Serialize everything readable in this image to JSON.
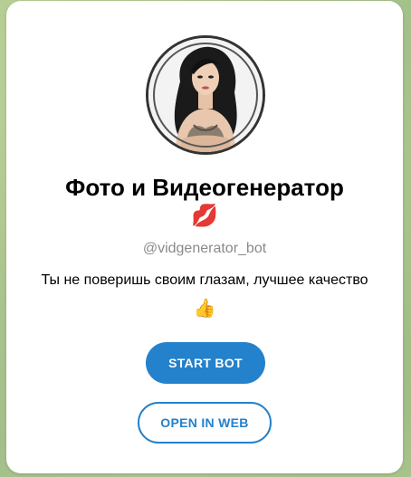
{
  "bot": {
    "title": "Фото и Видеогенератор",
    "title_emoji": "💋",
    "username": "@vidgenerator_bot",
    "description": "Ты не поверишь своим глазам, лучшее качество",
    "description_emoji": "👍"
  },
  "buttons": {
    "start_label": "START BOT",
    "web_label": "OPEN IN WEB"
  },
  "colors": {
    "accent": "#2481cc",
    "username": "#8a8a8a",
    "background": "#a9c48d"
  }
}
